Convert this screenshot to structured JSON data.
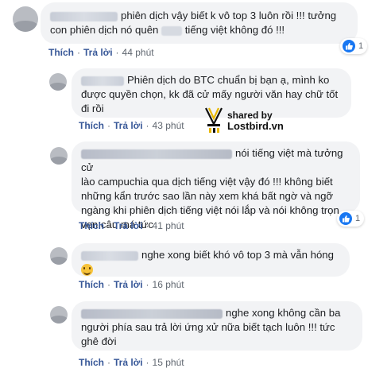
{
  "colors": {
    "bubble_bg": "#f2f3f5",
    "link": "#385898",
    "meta": "#606770",
    "like_blue": "#1877f2"
  },
  "comments": [
    {
      "text_a": "phiên dịch vậy biết k vô top 3 luôn rồi !!! tưởng",
      "text_b1": "con phiên dịch nó quên",
      "text_b2": "tiếng việt không đó !!!",
      "like": "Thích",
      "reply": "Trả lời",
      "time": "44 phút",
      "reaction_count": "1"
    },
    {
      "text_a": "Phiên dịch do BTC chuẩn bị bạn ạ, mình ko",
      "text_b": "được quyền chọn, kk đã cử mấy người văn hay chữ tốt",
      "text_c": "đi rồi",
      "like": "Thích",
      "reply": "Trả lời",
      "time": "43 phút"
    },
    {
      "text_a": "nói tiếng việt mà tưởng cử",
      "text_b": "lào campuchia qua dịch tiếng việt vậy đó !!! không biết",
      "text_c": "những kẩn trước sao lần này xem khá bất ngờ và ngỡ",
      "text_d": "ngàng khi phiên dịch tiếng việt nói lắp và nói không trọn",
      "text_e": "vẹn câu má tức",
      "like": "Thích",
      "reply": "Trả lời",
      "time": "41 phút",
      "reaction_count": "1"
    },
    {
      "text_a": "nghe xong biết khó vô top 3 mà vẫn hóng",
      "like": "Thích",
      "reply": "Trả lời",
      "time": "16 phút"
    },
    {
      "text_a": "nghe xong không cần ba",
      "text_b": "người phía sau trả lời ứng xử nữa biết tạch luôn !!! tức",
      "text_c": "ghê đời",
      "like": "Thích",
      "reply": "Trả lời",
      "time": "15 phút"
    }
  ],
  "watermark": {
    "line1": "shared by",
    "line2": "Lostbird.vn"
  }
}
